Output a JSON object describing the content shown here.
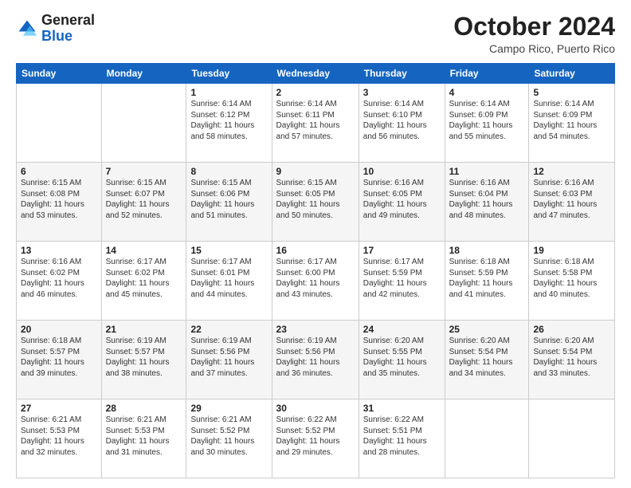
{
  "header": {
    "logo_general": "General",
    "logo_blue": "Blue",
    "month": "October 2024",
    "location": "Campo Rico, Puerto Rico"
  },
  "weekdays": [
    "Sunday",
    "Monday",
    "Tuesday",
    "Wednesday",
    "Thursday",
    "Friday",
    "Saturday"
  ],
  "weeks": [
    [
      {
        "day": "",
        "info": ""
      },
      {
        "day": "",
        "info": ""
      },
      {
        "day": "1",
        "info": "Sunrise: 6:14 AM\nSunset: 6:12 PM\nDaylight: 11 hours and 58 minutes."
      },
      {
        "day": "2",
        "info": "Sunrise: 6:14 AM\nSunset: 6:11 PM\nDaylight: 11 hours and 57 minutes."
      },
      {
        "day": "3",
        "info": "Sunrise: 6:14 AM\nSunset: 6:10 PM\nDaylight: 11 hours and 56 minutes."
      },
      {
        "day": "4",
        "info": "Sunrise: 6:14 AM\nSunset: 6:09 PM\nDaylight: 11 hours and 55 minutes."
      },
      {
        "day": "5",
        "info": "Sunrise: 6:14 AM\nSunset: 6:09 PM\nDaylight: 11 hours and 54 minutes."
      }
    ],
    [
      {
        "day": "6",
        "info": "Sunrise: 6:15 AM\nSunset: 6:08 PM\nDaylight: 11 hours and 53 minutes."
      },
      {
        "day": "7",
        "info": "Sunrise: 6:15 AM\nSunset: 6:07 PM\nDaylight: 11 hours and 52 minutes."
      },
      {
        "day": "8",
        "info": "Sunrise: 6:15 AM\nSunset: 6:06 PM\nDaylight: 11 hours and 51 minutes."
      },
      {
        "day": "9",
        "info": "Sunrise: 6:15 AM\nSunset: 6:05 PM\nDaylight: 11 hours and 50 minutes."
      },
      {
        "day": "10",
        "info": "Sunrise: 6:16 AM\nSunset: 6:05 PM\nDaylight: 11 hours and 49 minutes."
      },
      {
        "day": "11",
        "info": "Sunrise: 6:16 AM\nSunset: 6:04 PM\nDaylight: 11 hours and 48 minutes."
      },
      {
        "day": "12",
        "info": "Sunrise: 6:16 AM\nSunset: 6:03 PM\nDaylight: 11 hours and 47 minutes."
      }
    ],
    [
      {
        "day": "13",
        "info": "Sunrise: 6:16 AM\nSunset: 6:02 PM\nDaylight: 11 hours and 46 minutes."
      },
      {
        "day": "14",
        "info": "Sunrise: 6:17 AM\nSunset: 6:02 PM\nDaylight: 11 hours and 45 minutes."
      },
      {
        "day": "15",
        "info": "Sunrise: 6:17 AM\nSunset: 6:01 PM\nDaylight: 11 hours and 44 minutes."
      },
      {
        "day": "16",
        "info": "Sunrise: 6:17 AM\nSunset: 6:00 PM\nDaylight: 11 hours and 43 minutes."
      },
      {
        "day": "17",
        "info": "Sunrise: 6:17 AM\nSunset: 5:59 PM\nDaylight: 11 hours and 42 minutes."
      },
      {
        "day": "18",
        "info": "Sunrise: 6:18 AM\nSunset: 5:59 PM\nDaylight: 11 hours and 41 minutes."
      },
      {
        "day": "19",
        "info": "Sunrise: 6:18 AM\nSunset: 5:58 PM\nDaylight: 11 hours and 40 minutes."
      }
    ],
    [
      {
        "day": "20",
        "info": "Sunrise: 6:18 AM\nSunset: 5:57 PM\nDaylight: 11 hours and 39 minutes."
      },
      {
        "day": "21",
        "info": "Sunrise: 6:19 AM\nSunset: 5:57 PM\nDaylight: 11 hours and 38 minutes."
      },
      {
        "day": "22",
        "info": "Sunrise: 6:19 AM\nSunset: 5:56 PM\nDaylight: 11 hours and 37 minutes."
      },
      {
        "day": "23",
        "info": "Sunrise: 6:19 AM\nSunset: 5:56 PM\nDaylight: 11 hours and 36 minutes."
      },
      {
        "day": "24",
        "info": "Sunrise: 6:20 AM\nSunset: 5:55 PM\nDaylight: 11 hours and 35 minutes."
      },
      {
        "day": "25",
        "info": "Sunrise: 6:20 AM\nSunset: 5:54 PM\nDaylight: 11 hours and 34 minutes."
      },
      {
        "day": "26",
        "info": "Sunrise: 6:20 AM\nSunset: 5:54 PM\nDaylight: 11 hours and 33 minutes."
      }
    ],
    [
      {
        "day": "27",
        "info": "Sunrise: 6:21 AM\nSunset: 5:53 PM\nDaylight: 11 hours and 32 minutes."
      },
      {
        "day": "28",
        "info": "Sunrise: 6:21 AM\nSunset: 5:53 PM\nDaylight: 11 hours and 31 minutes."
      },
      {
        "day": "29",
        "info": "Sunrise: 6:21 AM\nSunset: 5:52 PM\nDaylight: 11 hours and 30 minutes."
      },
      {
        "day": "30",
        "info": "Sunrise: 6:22 AM\nSunset: 5:52 PM\nDaylight: 11 hours and 29 minutes."
      },
      {
        "day": "31",
        "info": "Sunrise: 6:22 AM\nSunset: 5:51 PM\nDaylight: 11 hours and 28 minutes."
      },
      {
        "day": "",
        "info": ""
      },
      {
        "day": "",
        "info": ""
      }
    ]
  ]
}
